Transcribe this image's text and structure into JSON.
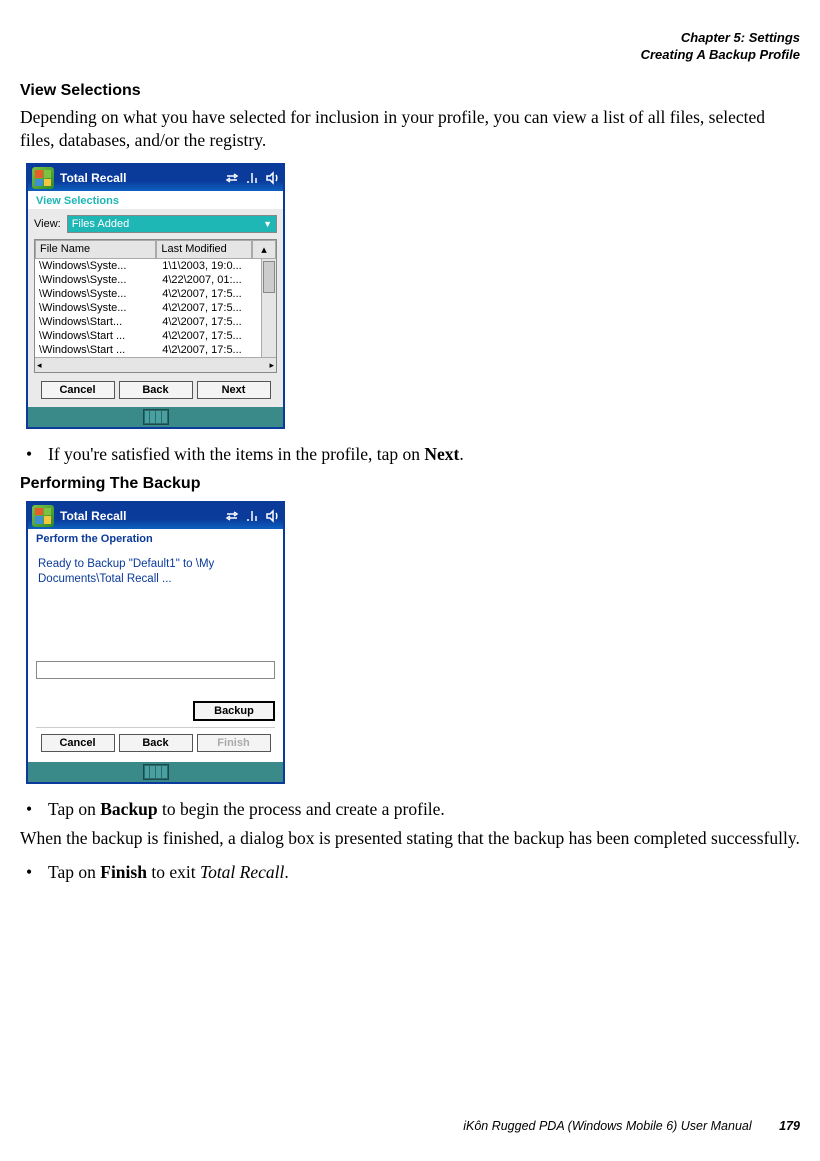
{
  "header": {
    "chapter": "Chapter 5:  Settings",
    "section": "Creating A Backup Profile"
  },
  "h1": "View Selections",
  "p1": "Depending on what you have selected for inclusion in your profile, you can view a list of all files, selected files, databases, and/or the registry.",
  "ss1": {
    "title": "Total Recall",
    "subtitle": "View Selections",
    "view_label": "View:",
    "view_value": "Files Added",
    "col_name": "File Name",
    "col_mod": "Last Modified",
    "rows": [
      {
        "f": "\\Windows\\Syste...",
        "m": "1\\1\\2003, 19:0..."
      },
      {
        "f": "\\Windows\\Syste...",
        "m": "4\\22\\2007, 01:..."
      },
      {
        "f": "\\Windows\\Syste...",
        "m": "4\\2\\2007, 17:5..."
      },
      {
        "f": "\\Windows\\Syste...",
        "m": "4\\2\\2007, 17:5..."
      },
      {
        "f": "\\Windows\\Start...",
        "m": "4\\2\\2007, 17:5..."
      },
      {
        "f": "\\Windows\\Start ...",
        "m": "4\\2\\2007, 17:5..."
      },
      {
        "f": "\\Windows\\Start ...",
        "m": "4\\2\\2007, 17:5..."
      }
    ],
    "btn_cancel": "Cancel",
    "btn_back": "Back",
    "btn_next": "Next"
  },
  "b1_pre": "If you're satisfied with the items in the profile, tap on ",
  "b1_bold": "Next",
  "b1_post": ".",
  "h2": "Performing The Backup",
  "ss2": {
    "title": "Total Recall",
    "subtitle": "Perform the Operation",
    "msg": "Ready to Backup \"Default1\" to \\My Documents\\Total Recall ...",
    "btn_backup": "Backup",
    "btn_cancel": "Cancel",
    "btn_back": "Back",
    "btn_finish": "Finish"
  },
  "b2_pre": "Tap on ",
  "b2_bold": "Backup",
  "b2_post": " to begin the process and create a profile.",
  "p2": "When the backup is finished, a dialog box is presented stating that the backup has been completed successfully.",
  "b3_pre": "Tap on ",
  "b3_bold": "Finish",
  "b3_mid": " to exit ",
  "b3_ital": "Total Recall",
  "b3_post": ".",
  "footer": {
    "text": "iKôn Rugged PDA (Windows Mobile 6) User Manual",
    "page": "179"
  }
}
